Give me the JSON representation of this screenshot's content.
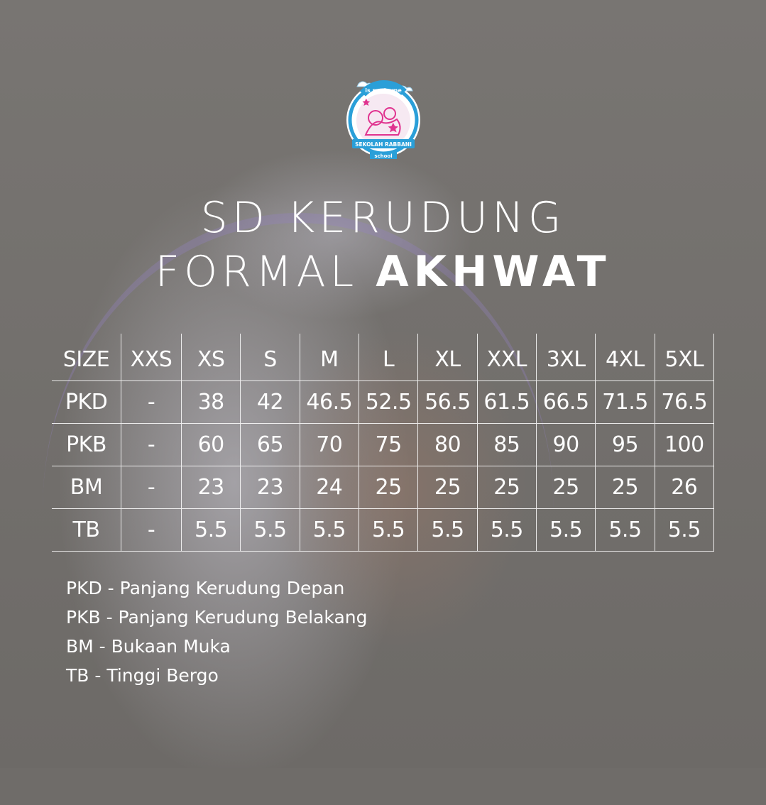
{
  "logo": {
    "top_text": "is my home",
    "banner_text": "SEKOLAH RABBANI",
    "bottom_text": "school"
  },
  "title": {
    "line1": "SD KERUDUNG",
    "line2_regular": "FORMAL",
    "line2_bold": "AKHWAT"
  },
  "table": {
    "header": [
      "SIZE",
      "XXS",
      "XS",
      "S",
      "M",
      "L",
      "XL",
      "XXL",
      "3XL",
      "4XL",
      "5XL"
    ],
    "rows": [
      [
        "PKD",
        "-",
        "38",
        "42",
        "46.5",
        "52.5",
        "56.5",
        "61.5",
        "66.5",
        "71.5",
        "76.5"
      ],
      [
        "PKB",
        "-",
        "60",
        "65",
        "70",
        "75",
        "80",
        "85",
        "90",
        "95",
        "100"
      ],
      [
        "BM",
        "-",
        "23",
        "23",
        "24",
        "25",
        "25",
        "25",
        "25",
        "25",
        "26"
      ],
      [
        "TB",
        "-",
        "5.5",
        "5.5",
        "5.5",
        "5.5",
        "5.5",
        "5.5",
        "5.5",
        "5.5",
        "5.5"
      ]
    ]
  },
  "legend": [
    "PKD - Panjang Kerudung Depan",
    "PKB - Panjang Kerudung Belakang",
    "BM - Bukaan Muka",
    "TB - Tinggi Bergo"
  ],
  "colors": {
    "background": "#6f6c69",
    "text": "#ffffff",
    "logo_pink": "#e0338f",
    "logo_blue": "#2a9fd8"
  }
}
